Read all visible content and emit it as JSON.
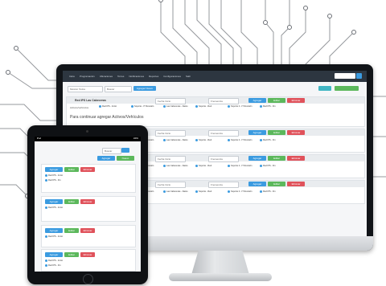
{
  "colors": {
    "accent": "#3b9be0",
    "success": "#5cb85c",
    "danger": "#e0525b",
    "navbar": "#2d3640"
  },
  "monitor": {
    "nav_links": [
      "Inicio",
      "Programación",
      "Ubicaciones",
      "Torres",
      "Notificaciones",
      "Reportes",
      "Configuraciones",
      "Salir"
    ],
    "toolbar": {
      "filter_select": "Mostrar Todos",
      "search_placeholder": "Buscar",
      "primary_button": "Agregar Nuevo"
    },
    "rows": [
      {
        "title": "Red IPS Las Cabeceras",
        "date_select": "Fecha Inicio",
        "freq_select": "Frecuencia",
        "chips": [
          "Red IPS - Inicio",
          "Soporte - IT Revisión",
          "Las Cabeceras - Datos",
          "Soporte - Red",
          "Soporte 2 - IT Revisión",
          "Red IPS - Fin"
        ],
        "note_label": "Activos/vehículos",
        "note": "Para continuar agregar Activos/Vehículos",
        "actions": [
          "Agregar",
          "Editar",
          "Eliminar"
        ]
      },
      {
        "title": "Red IPS Las Cabeceras",
        "date_select": "Fecha Inicio",
        "freq_select": "Frecuencia",
        "chips": [
          "Red IPS - Inicio",
          "Soporte - IT Revisión",
          "Las Cabeceras - Datos",
          "Soporte - Red",
          "Soporte 2 - IT Revisión",
          "Red IPS - Fin"
        ],
        "note_label": "",
        "note": "",
        "actions": [
          "Agregar",
          "Editar",
          "Eliminar"
        ]
      },
      {
        "title": "Red IPS Las Cabeceras",
        "date_select": "Fecha Inicio",
        "freq_select": "Frecuencia",
        "chips": [
          "Red IPS - Inicio",
          "Soporte - IT Revisión",
          "Las Cabeceras - Datos",
          "Soporte - Red",
          "Soporte 2 - IT Revisión",
          "Red IPS - Fin"
        ],
        "note_label": "",
        "note": "",
        "actions": [
          "Agregar",
          "Editar",
          "Eliminar"
        ]
      },
      {
        "title": "Red IPS Las Cabeceras",
        "date_select": "Fecha Inicio",
        "freq_select": "Frecuencia",
        "chips": [
          "Red IPS - Inicio",
          "Soporte - IT Revisión",
          "Las Cabeceras - Datos",
          "Soporte - Red",
          "Soporte 2 - IT Revisión",
          "Red IPS - Fin"
        ],
        "note_label": "",
        "note": "",
        "actions": [
          "Agregar",
          "Editar",
          "Eliminar"
        ]
      }
    ]
  },
  "tablet": {
    "status_left": "iPad",
    "status_right": "100%",
    "search_placeholder": "Buscar",
    "top_buttons": [
      "Agregar",
      "Nuevo"
    ],
    "cards": [
      {
        "actions": [
          "Agregar",
          "Editar",
          "Eliminar"
        ],
        "chips": [
          "Red IPS - Inicio",
          "Red IPS - Fin"
        ]
      },
      {
        "actions": [
          "Agregar",
          "Editar",
          "Eliminar"
        ],
        "chips": [
          "Red IPS - Inicio"
        ]
      },
      {
        "actions": [
          "Agregar",
          "Editar",
          "Eliminar"
        ],
        "chips": [
          "Red IPS - Inicio"
        ]
      },
      {
        "actions": [
          "Agregar",
          "Editar",
          "Eliminar"
        ],
        "chips": [
          "Red IPS - Inicio",
          "Red IPS - Fin"
        ]
      }
    ]
  }
}
